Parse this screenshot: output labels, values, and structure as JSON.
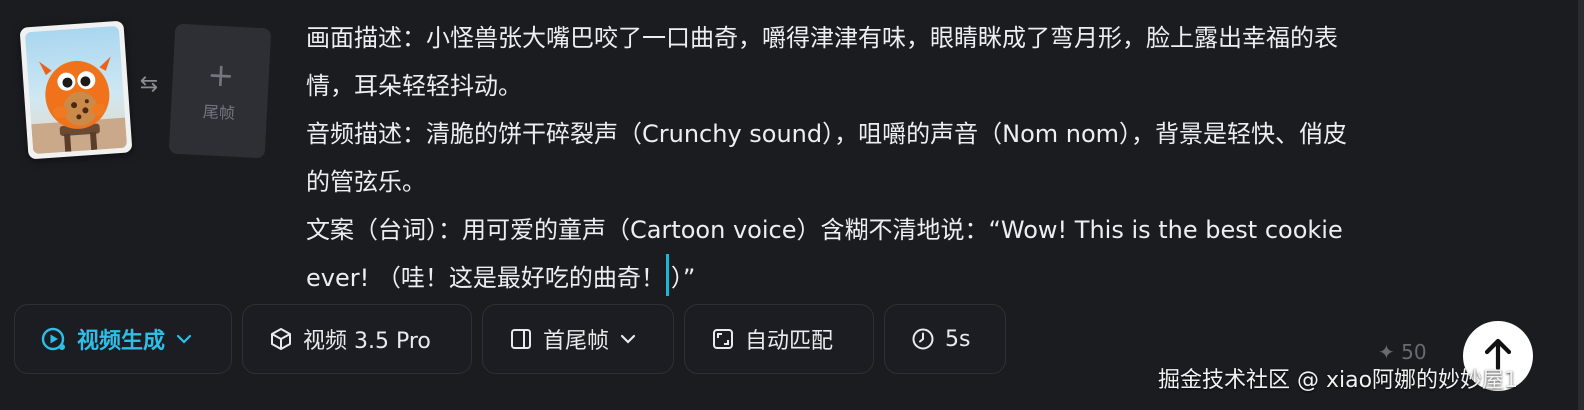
{
  "frames": {
    "last_frame_label": "尾帧"
  },
  "prompt": {
    "line1": "画面描述：小怪兽张大嘴巴咬了一口曲奇，嚼得津津有味，眼睛眯成了弯月形，脸上露出幸福的表",
    "line2": "情，耳朵轻轻抖动。",
    "line3": "音频描述：清脆的饼干碎裂声（Crunchy sound），咀嚼的声音（Nom nom），背景是轻快、俏皮",
    "line4": "的管弦乐。",
    "line5": "文案（台词）：用可爱的童声（Cartoon voice）含糊不清地说：“Wow! This is the best cookie",
    "line6_before_cursor": "ever! （哇！这是最好吃的曲奇！",
    "line6_after_cursor": "）”"
  },
  "toolbar": {
    "mode_label": "视频生成",
    "model_label": "视频 3.5 Pro",
    "frame_mode_label": "首尾帧",
    "ratio_label": "自动匹配",
    "duration_label": "5s"
  },
  "credits": "✦ 50",
  "watermark": "掘金技术社区 @ xiao阿娜的妙妙屋1",
  "colors": {
    "background": "#1b1c20",
    "accent": "#2dbfe6",
    "cursor": "#1ab7d6"
  }
}
